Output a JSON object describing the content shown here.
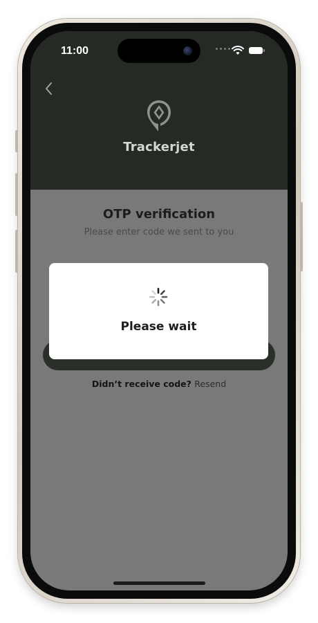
{
  "status_bar": {
    "time": "11:00",
    "icons": [
      "cellular-dots-icon",
      "wifi-icon",
      "battery-icon"
    ]
  },
  "header": {
    "back_icon": "chevron-left-icon",
    "logo_icon": "location-pin-logo-icon",
    "brand_name": "Trackerjet",
    "background_color": "#252a25"
  },
  "otp": {
    "title": "OTP verification",
    "subtitle": "Please enter code we sent to you"
  },
  "resend": {
    "prefix": "Didn’t receive code?",
    "link_label": "Resend"
  },
  "loading_dialog": {
    "spinner_icon": "activity-spinner-icon",
    "message": "Please wait"
  },
  "colors": {
    "overlay_dim": "#797979",
    "primary_dark": "#2a2f2a",
    "dialog_background": "#ffffff"
  }
}
